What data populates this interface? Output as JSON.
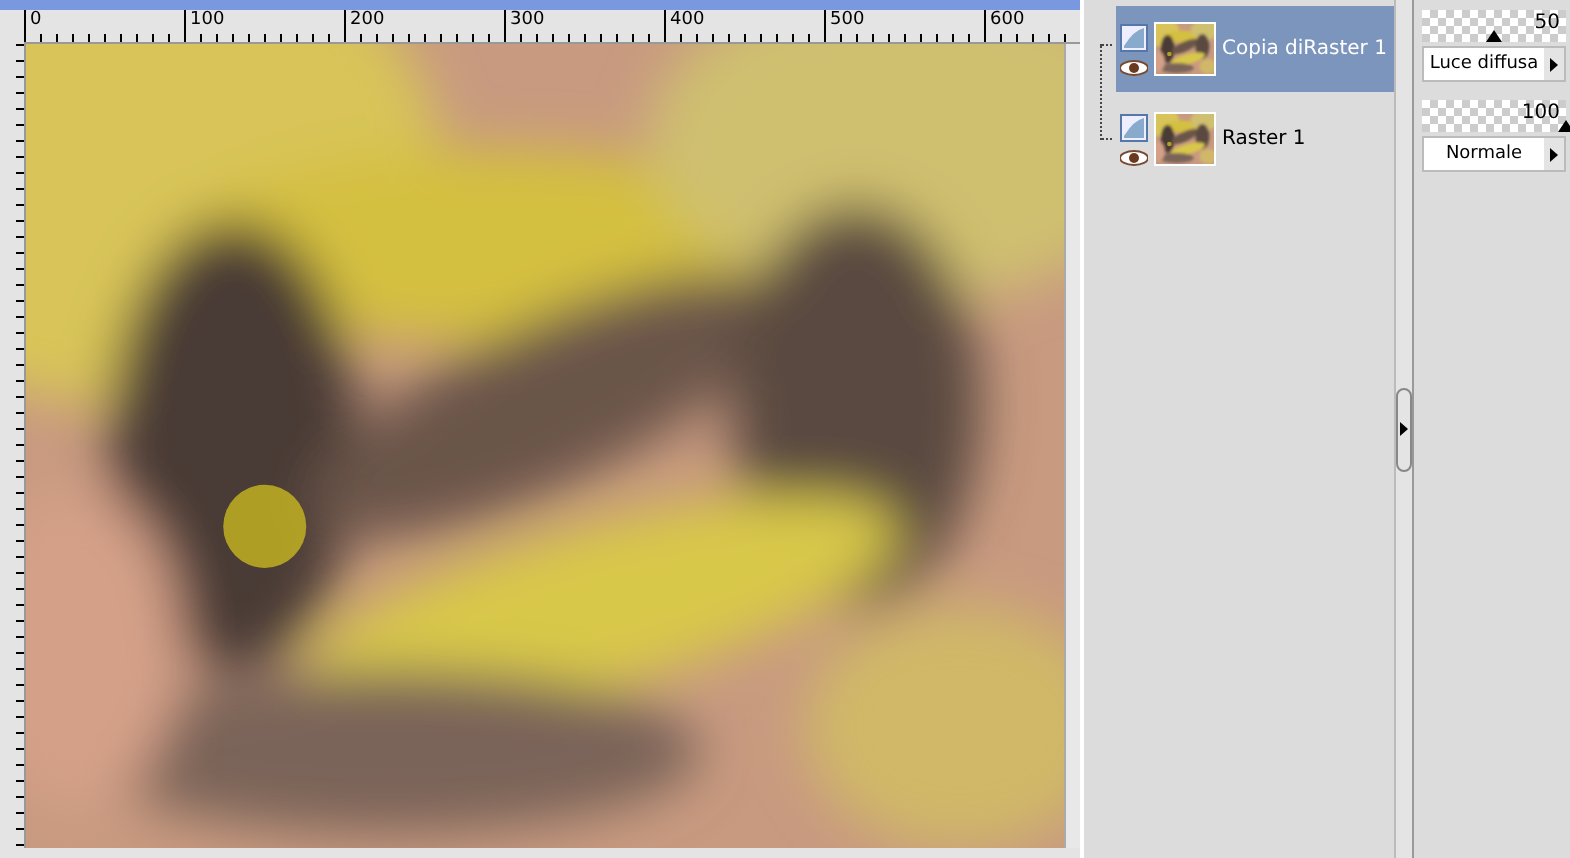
{
  "ruler": {
    "labels": [
      "0",
      "100",
      "200",
      "300",
      "400",
      "500",
      "600"
    ]
  },
  "layers": [
    {
      "name": "Copia diRaster 1",
      "selected": true,
      "opacity": "50",
      "level": 0.5,
      "blend": "Luce diffusa"
    },
    {
      "name": "Raster 1",
      "selected": false,
      "opacity": "100",
      "level": 1.0,
      "blend": "Normale"
    }
  ]
}
